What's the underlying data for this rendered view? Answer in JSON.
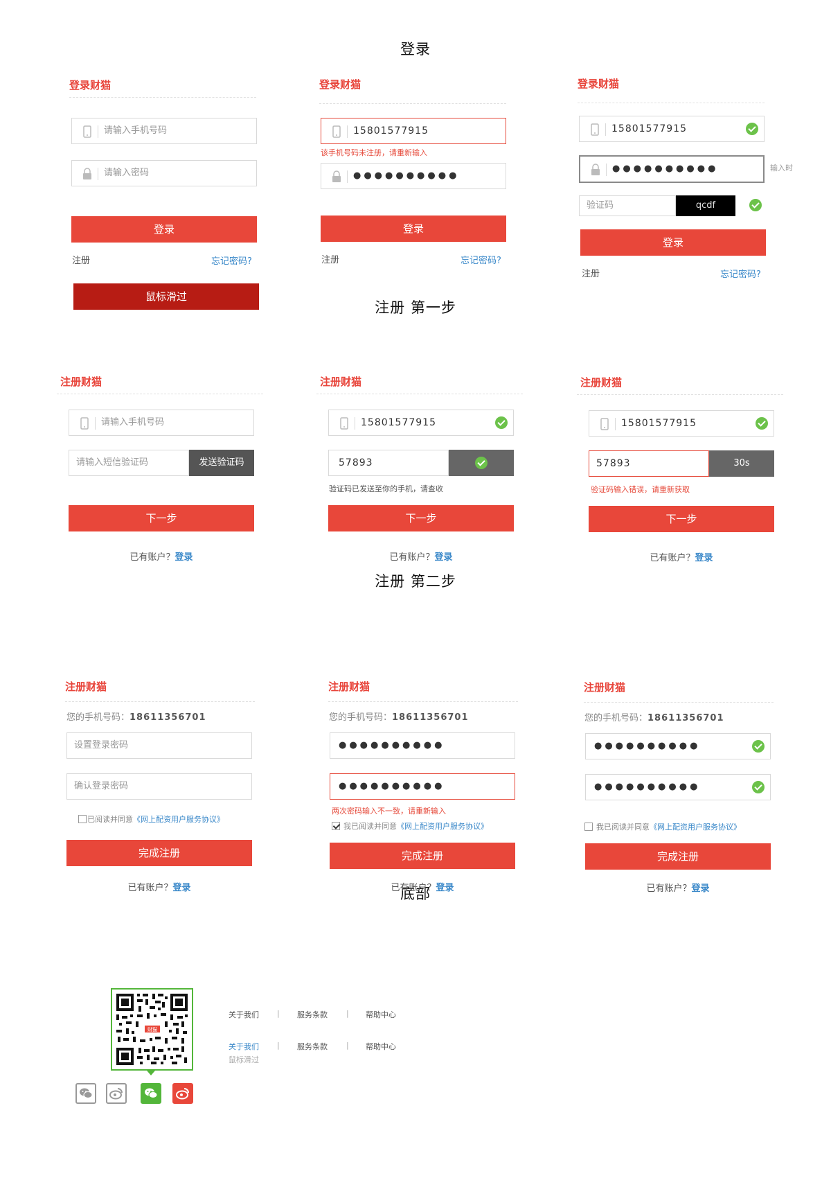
{
  "sections": {
    "login": "登录",
    "reg1": "注册  第一步",
    "reg2": "注册  第二步",
    "footer": "底部"
  },
  "login": {
    "title": "登录财猫",
    "phone_placeholder": "请输入手机号码",
    "pwd_placeholder": "请输入密码",
    "phone_value": "15801577915",
    "pwd_dots": "●●●●●●●●●●",
    "phone_error": "该手机号码未注册，请重新输入",
    "captcha_placeholder": "验证码",
    "captcha_image_text": "qcdf",
    "typing_hint": "输入时",
    "login_button": "登录",
    "register_link": "注册",
    "forgot_link": "忘记密码?",
    "hover_button": "鼠标滑过"
  },
  "reg1": {
    "title": "注册财猫",
    "phone_placeholder": "请输入手机号码",
    "sms_placeholder": "请输入短信验证码",
    "send_code_button": "发送验证码",
    "phone_value": "15801577915",
    "code_value": "57893",
    "countdown": "30s",
    "sent_info": "验证码已发送至你的手机，请查收",
    "code_error": "验证码输入错误，请重新获取",
    "next_button": "下一步",
    "has_account": "已有账户？",
    "login_link": "登录"
  },
  "reg2": {
    "title": "注册财猫",
    "phone_label": "您的手机号码：",
    "phone_value": "18611356701",
    "set_pwd_placeholder": "设置登录密码",
    "confirm_pwd_placeholder": "确认登录密码",
    "pwd_dots": "●●●●●●●●●●",
    "mismatch_error": "两次密码输入不一致，请重新输入",
    "agree_text": "我已阅读并同意",
    "agree_text_first": "已阅读并同意",
    "agreement_link": "《网上配资用户服务协议》",
    "finish_button": "完成注册",
    "has_account": "已有账户？",
    "login_link": "登录"
  },
  "footer": {
    "links": [
      "关于我们",
      "服务条款",
      "帮助中心"
    ],
    "separator": "|",
    "hover_label": "鼠标滑过",
    "qr_badge": "财猫",
    "colors": {
      "wechat": "#53b63a",
      "weibo": "#e8473a",
      "gray": "#999999"
    }
  },
  "colors": {
    "accent": "#e8473a",
    "link": "#3a88c9",
    "success": "#6cc24a"
  }
}
